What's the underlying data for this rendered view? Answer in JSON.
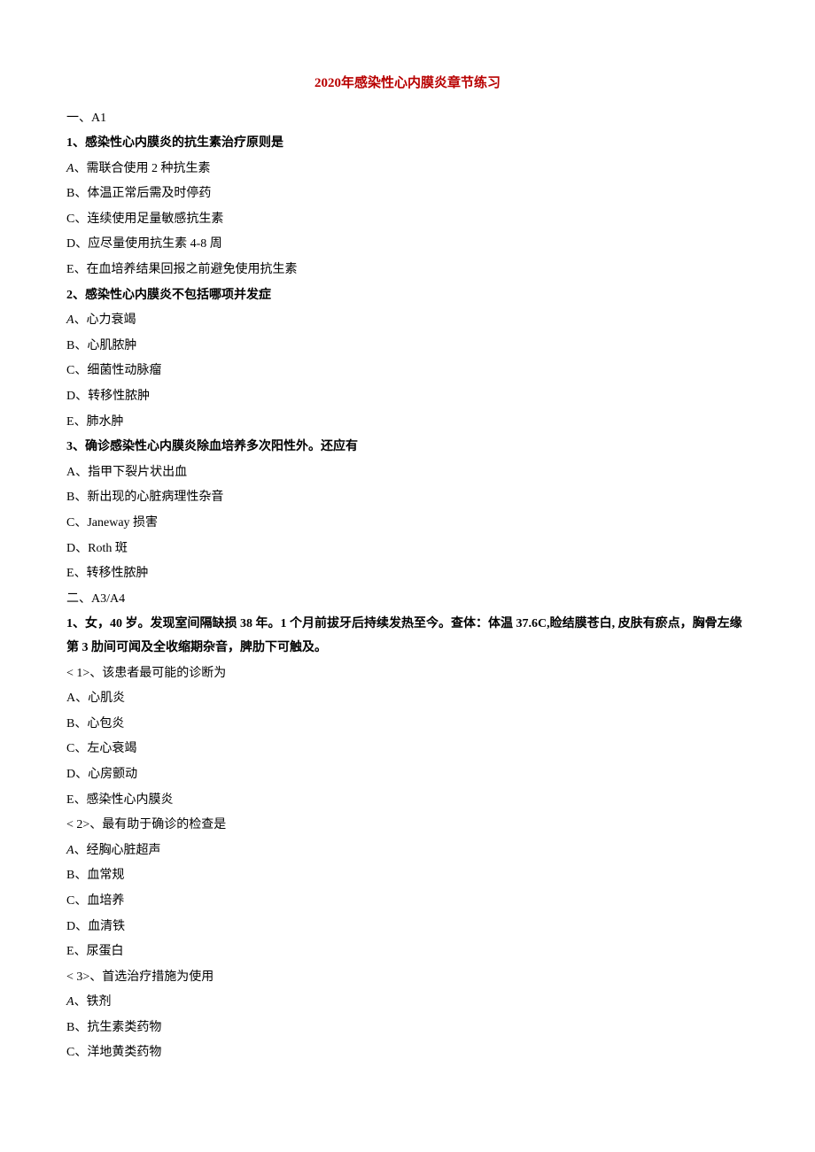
{
  "title": {
    "year": "2020",
    "rest": "年感染性心内膜炎章节练习"
  },
  "sectionA": {
    "label": "一、A1",
    "q1": {
      "stem_num": "1、",
      "stem_text": "感染性心内膜炎的抗生素治疗原则是",
      "optA_letter": "A",
      "optA": "、需联合使用 2 种抗生素",
      "optB_letter": "B",
      "optB": "、体温正常后需及时停药",
      "optC_letter": "C",
      "optC": "、连续使用足量敏感抗生素",
      "optD_letter": "D",
      "optD": "、应尽量使用抗生素 4-8 周",
      "optE_letter": "E",
      "optE": "、在血培养结果回报之前避免使用抗生素"
    },
    "q2": {
      "stem_num": "2、",
      "stem_text": "感染性心内膜炎不包括哪项并发症",
      "optA_letter": "A",
      "optA": "、心力衰竭",
      "optB_letter": "B",
      "optB": "、心肌脓肿",
      "optC_letter": "C",
      "optC": "、细菌性动脉瘤",
      "optD_letter": "D",
      "optD": "、转移性脓肿",
      "optE_letter": "E",
      "optE": "、肺水肿"
    },
    "q3": {
      "stem_num": "3、",
      "stem_text": "确诊感染性心内膜炎除血培养多次阳性外。还应有",
      "optA_letter": "A",
      "optA": "、指甲下裂片状出血",
      "optB_letter": "B",
      "optB": "、新出现的心脏病理性杂音",
      "optC_letter": "C",
      "optC": "、Janeway 损害",
      "optD_letter": "D",
      "optD": "、Roth 斑",
      "optE_letter": "E",
      "optE": "、转移性脓肿"
    }
  },
  "sectionB": {
    "label": "二、A3/A4",
    "vignette": {
      "num": "1、",
      "part1": "女，40 岁。发现室间隔缺损 38 年。1 个月前拔牙后持续发热至今。查体：体温 37.6C,睑结膜苍白, 皮肤有瘀点，胸骨左缘第 3 肋间可闻及全收缩期杂音，脾肋下可触及。"
    },
    "sub1": {
      "label": "< 1>、该患者最可能的诊断为",
      "optA_letter": "A",
      "optA": "、心肌炎",
      "optB_letter": "B",
      "optB": "、心包炎",
      "optC_letter": "C",
      "optC": "、左心衰竭",
      "optD_letter": "D",
      "optD": "、心房颤动",
      "optE_letter": "E",
      "optE": "、感染性心内膜炎"
    },
    "sub2": {
      "label": "< 2>、最有助于确诊的检查是",
      "optA_letter": "A",
      "optA": "、经胸心脏超声",
      "optB_letter": "B",
      "optB": "、血常规",
      "optC_letter": "C",
      "optC": "、血培养",
      "optD_letter": "D",
      "optD": "、血清铁",
      "optE_letter": "E",
      "optE": "、尿蛋白"
    },
    "sub3": {
      "label": "< 3>、首选治疗措施为使用",
      "optA_letter": "A",
      "optA": "、铁剂",
      "optB_letter": "B",
      "optB": "、抗生素类药物",
      "optC_letter": "C",
      "optC": "、洋地黄类药物"
    }
  }
}
